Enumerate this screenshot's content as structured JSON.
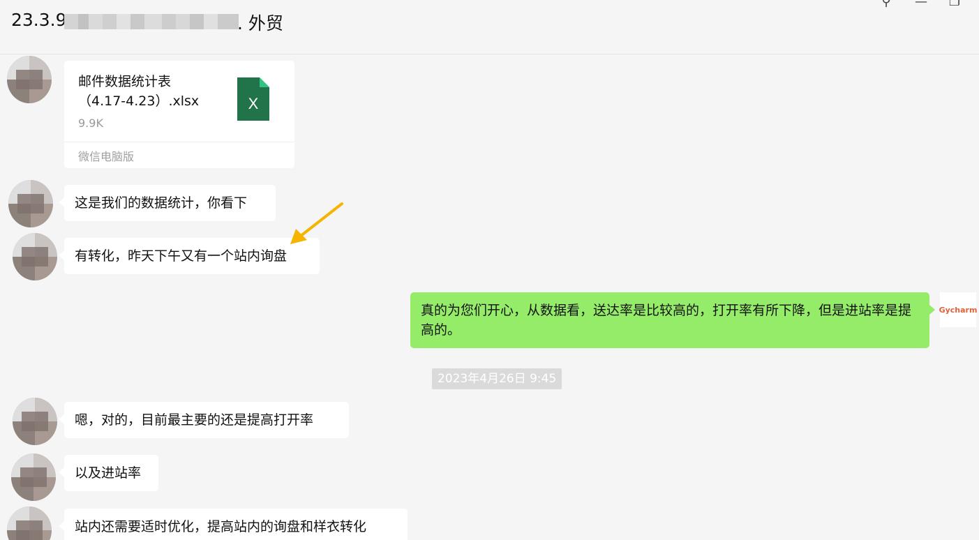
{
  "window": {
    "title_prefix": "23.3.9",
    "title_suffix": ". 外贸",
    "controls": {
      "pin": "⚲",
      "minimize": "—",
      "maximize": "❐"
    }
  },
  "file_message": {
    "filename": "邮件数据统计表（4.17-4.23）.xlsx",
    "size": "9.9K",
    "source": "微信电脑版",
    "icon_letter": "X",
    "icon_color": "#21734a"
  },
  "messages": [
    {
      "side": "left",
      "text": "这是我们的数据统计，你看下"
    },
    {
      "side": "left",
      "text": "有转化，昨天下午又有一个站内询盘"
    },
    {
      "side": "right",
      "text": "真的为您们开心，从数据看，送达率是比较高的，打开率有所下降，但是进站率是提高的。"
    },
    {
      "side": "left",
      "text": "嗯，对的，目前最主要的还是提高打开率"
    },
    {
      "side": "left",
      "text": "以及进站率"
    },
    {
      "side": "left",
      "text": "站内还需要适时优化，提高站内的询盘和样衣转化"
    }
  ],
  "timestamp": "2023年4月26日 9:45",
  "self_avatar_text": "Gycharm",
  "colors": {
    "bubble_self": "#95ec69",
    "bubble_other": "#ffffff",
    "background": "#f5f5f5",
    "arrow": "#f5b400"
  }
}
